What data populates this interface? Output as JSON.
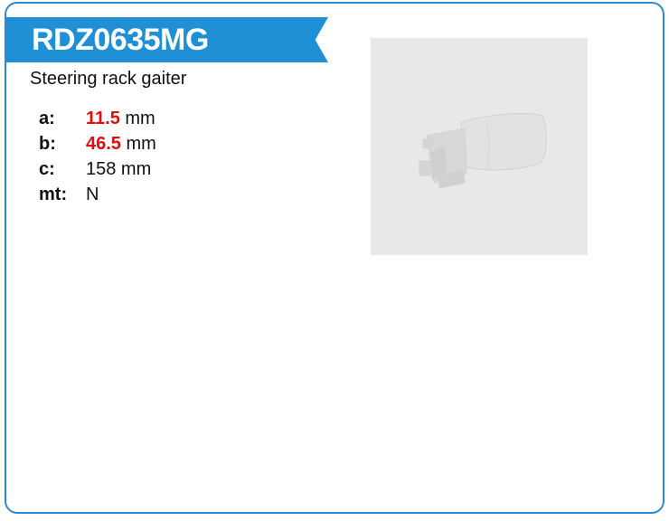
{
  "product": {
    "code": "RDZ0635MG",
    "description": "Steering rack gaiter"
  },
  "specs": [
    {
      "label": "a:",
      "value": "11.5",
      "unit": " mm",
      "highlight": true
    },
    {
      "label": "b:",
      "value": "46.5",
      "unit": " mm",
      "highlight": true
    },
    {
      "label": "c:",
      "value": "158",
      "unit": " mm",
      "highlight": false
    },
    {
      "label": "mt:",
      "value": "N",
      "unit": "",
      "highlight": false
    }
  ],
  "colors": {
    "accent": "#1f8fd6",
    "border": "#2a8bd0",
    "highlight": "#e30b0b",
    "image_bg": "#e8e8e8"
  },
  "image": {
    "icon": "steering-rack-gaiter-image"
  }
}
